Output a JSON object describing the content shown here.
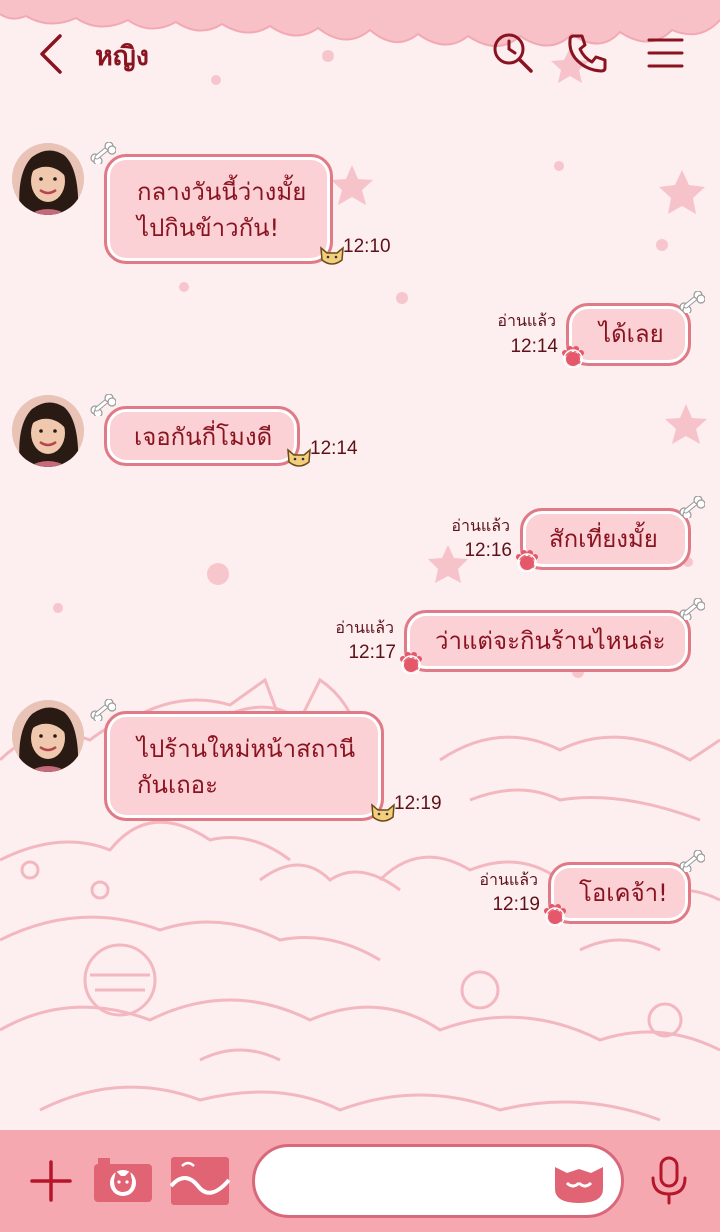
{
  "header": {
    "title": "หญิง",
    "icons": [
      "back-chevron-icon",
      "search-clock-icon",
      "phone-icon",
      "menu-icon"
    ]
  },
  "colors": {
    "background": "#fdeef0",
    "accent": "#8a1320",
    "bubble_fill": "#fbd1d6",
    "bubble_border": "#e07a87",
    "bottom_bar": "#f6a8b1"
  },
  "messages": [
    {
      "side": "left",
      "lines": [
        "กลางวันนี้ว่างมั้ย",
        "ไปกินข้าวกัน!"
      ],
      "time": "12:10"
    },
    {
      "side": "right",
      "lines": [
        "ได้เลย"
      ],
      "read": "อ่านแล้ว",
      "time": "12:14"
    },
    {
      "side": "left",
      "lines": [
        "เจอกันกี่โมงดี"
      ],
      "time": "12:14"
    },
    {
      "side": "right",
      "lines": [
        "สักเที่ยงมั้ย"
      ],
      "read": "อ่านแล้ว",
      "time": "12:16"
    },
    {
      "side": "right",
      "lines": [
        "ว่าแต่จะกินร้านไหนล่ะ"
      ],
      "read": "อ่านแล้ว",
      "time": "12:17"
    },
    {
      "side": "left",
      "lines": [
        "ไปร้านใหม่หน้าสถานี",
        "กันเถอะ"
      ],
      "time": "12:19"
    },
    {
      "side": "right",
      "lines": [
        "โอเคจ้า!"
      ],
      "read": "อ่านแล้ว",
      "time": "12:19"
    }
  ],
  "bottom_bar": {
    "icons": [
      "plus-icon",
      "camera-icon",
      "image-icon",
      "cat-sticker-icon",
      "mic-icon"
    ],
    "input_value": ""
  }
}
